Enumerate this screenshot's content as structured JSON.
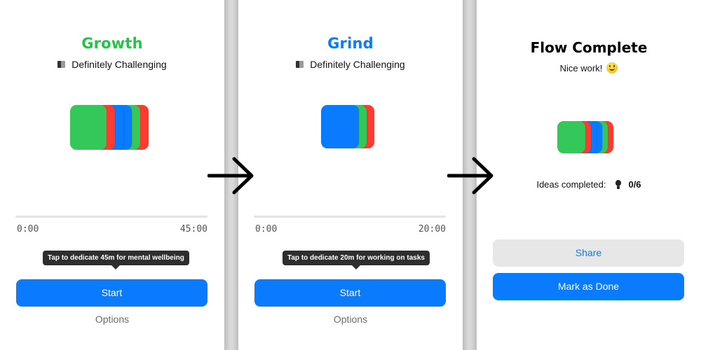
{
  "screens": [
    {
      "title": "Growth",
      "title_color": "#27c24a",
      "difficulty_label": "Definitely Challenging",
      "difficulty_icon": "difficulty-icon",
      "cards": [
        {
          "color": "#ff3b30"
        },
        {
          "color": "#34c759"
        },
        {
          "color": "#0a7aff"
        },
        {
          "color": "#0a7aff"
        },
        {
          "color": "#ff3b30"
        },
        {
          "color": "#34c759"
        }
      ],
      "timer": {
        "start": "0:00",
        "end": "45:00",
        "progress": 0
      },
      "tooltip": "Tap to dedicate 45m for mental wellbeing",
      "start_label": "Start",
      "options_label": "Options"
    },
    {
      "title": "Grind",
      "title_color": "#0a7aff",
      "difficulty_label": "Definitely Challenging",
      "difficulty_icon": "difficulty-icon",
      "cards": [
        {
          "color": "#ff3b30"
        },
        {
          "color": "#34c759"
        },
        {
          "color": "#0a7aff"
        }
      ],
      "timer": {
        "start": "0:00",
        "end": "20:00",
        "progress": 0
      },
      "tooltip": "Tap to dedicate 20m for working on tasks",
      "start_label": "Start",
      "options_label": "Options"
    },
    {
      "title": "Flow Complete",
      "message": "Nice work!",
      "message_icon": "smiley-icon",
      "cards": [
        {
          "color": "#ff3b30"
        },
        {
          "color": "#34c759"
        },
        {
          "color": "#0a7aff"
        },
        {
          "color": "#0a7aff"
        },
        {
          "color": "#ff3b30"
        },
        {
          "color": "#34c759"
        }
      ],
      "ideas_label": "Ideas completed:",
      "ideas_icon": "lightbulb-icon",
      "ideas_count": "0/6",
      "share_label": "Share",
      "done_label": "Mark as Done"
    }
  ],
  "colors": {
    "accent_blue": "#0a7aff",
    "green": "#34c759",
    "red": "#ff3b30",
    "secondary_button": "#e7e7e8"
  }
}
